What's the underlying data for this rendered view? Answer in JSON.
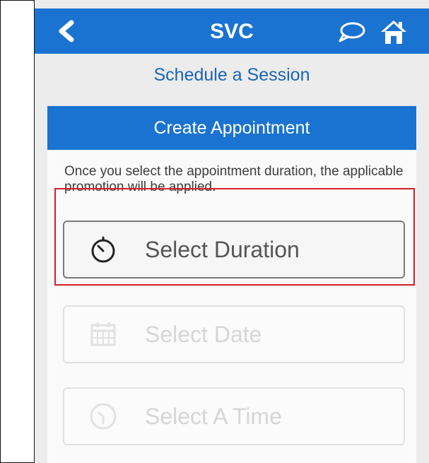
{
  "app": {
    "title": "SVC"
  },
  "subheader": {
    "title": "Schedule a Session"
  },
  "card": {
    "title": "Create Appointment",
    "info": "Once you select the appointment duration, the applicable promotion will be applied."
  },
  "buttons": {
    "duration": {
      "label": "Select Duration",
      "icon": "stopwatch-icon"
    },
    "date": {
      "label": "Select Date",
      "icon": "calendar-icon"
    },
    "time": {
      "label": "Select A Time",
      "icon": "clock-icon"
    }
  },
  "icons": {
    "back": "back-chevron-icon",
    "chat": "chat-bubble-icon",
    "home": "home-icon"
  },
  "colors": {
    "primary": "#1a73d0",
    "highlight": "#d21f2b",
    "background": "#ececec"
  }
}
